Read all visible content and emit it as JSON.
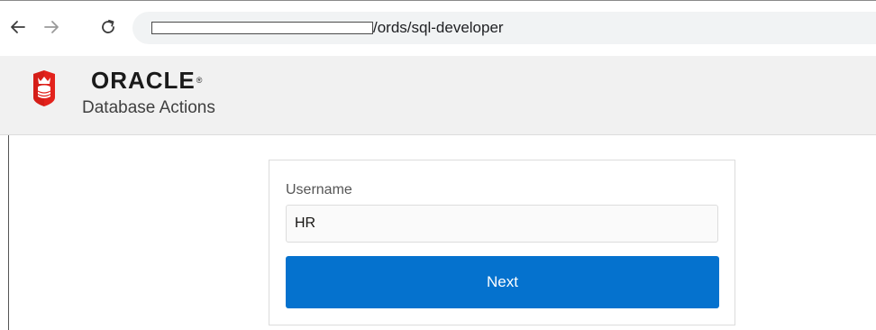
{
  "browser": {
    "url_path": "/ords/sql-developer",
    "back_icon": "arrow-left-icon",
    "forward_icon": "arrow-right-icon",
    "reload_icon": "reload-icon"
  },
  "header": {
    "logo_icon": "oracle-shield-icon",
    "brand": "ORACLE",
    "brand_mark": "®",
    "title": "Database Actions"
  },
  "login": {
    "username_label": "Username",
    "username_value": "HR",
    "next_label": "Next"
  },
  "colors": {
    "accent": "#0572ce",
    "logo_red": "#e3221c",
    "header_bg": "#f1f1f1"
  }
}
